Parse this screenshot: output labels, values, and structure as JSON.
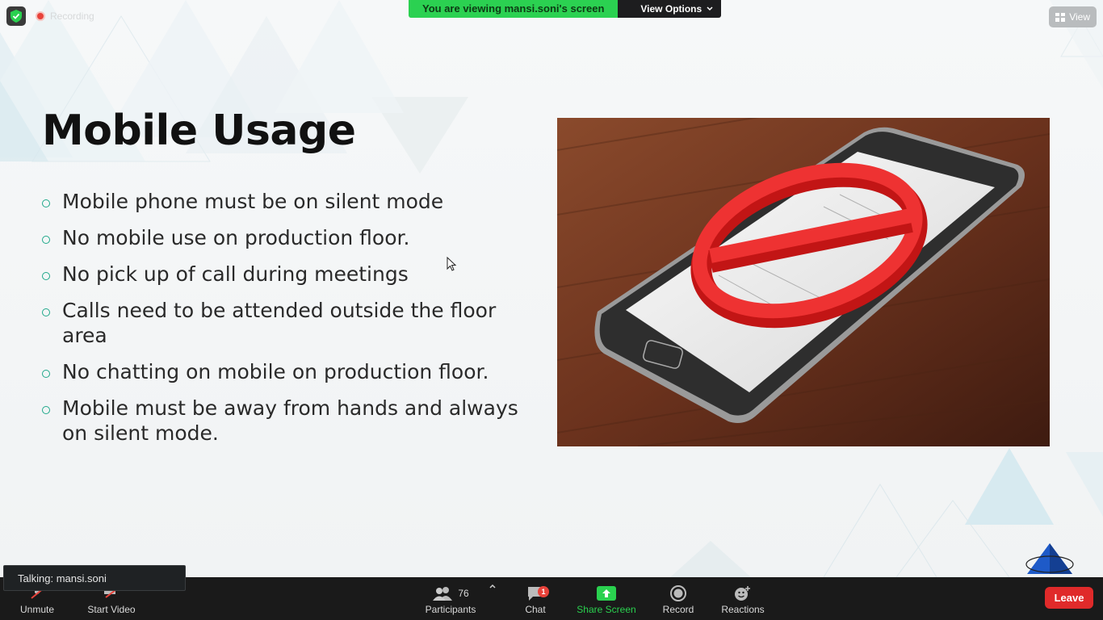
{
  "meeting": {
    "recording_label": "Recording",
    "banner_text": "You are viewing mansi.soni's screen",
    "view_options_label": "View Options",
    "view_label": "View"
  },
  "slide": {
    "title": "Mobile Usage",
    "bullets": [
      "Mobile phone must be on silent mode",
      "No mobile use on production floor.",
      "No pick up of call during meetings",
      "Calls need to be attended outside the floor area",
      "No chatting on mobile on production floor.",
      "Mobile must be away from hands and always on silent mode."
    ],
    "accent_color": "#1fa88a"
  },
  "talking_indicator": "Talking: mansi.soni",
  "toolbar": {
    "unmute_label": "Unmute",
    "start_video_label": "Start Video",
    "participants_label": "Participants",
    "participants_count": "76",
    "chat_label": "Chat",
    "chat_badge": "1",
    "share_screen_label": "Share Screen",
    "record_label": "Record",
    "reactions_label": "Reactions",
    "leave_label": "Leave"
  },
  "colors": {
    "toolbar_bg": "#1a1a1a",
    "share_green": "#2ad14f",
    "leave_red": "#e02a2a",
    "banner_green": "#2bd151"
  }
}
